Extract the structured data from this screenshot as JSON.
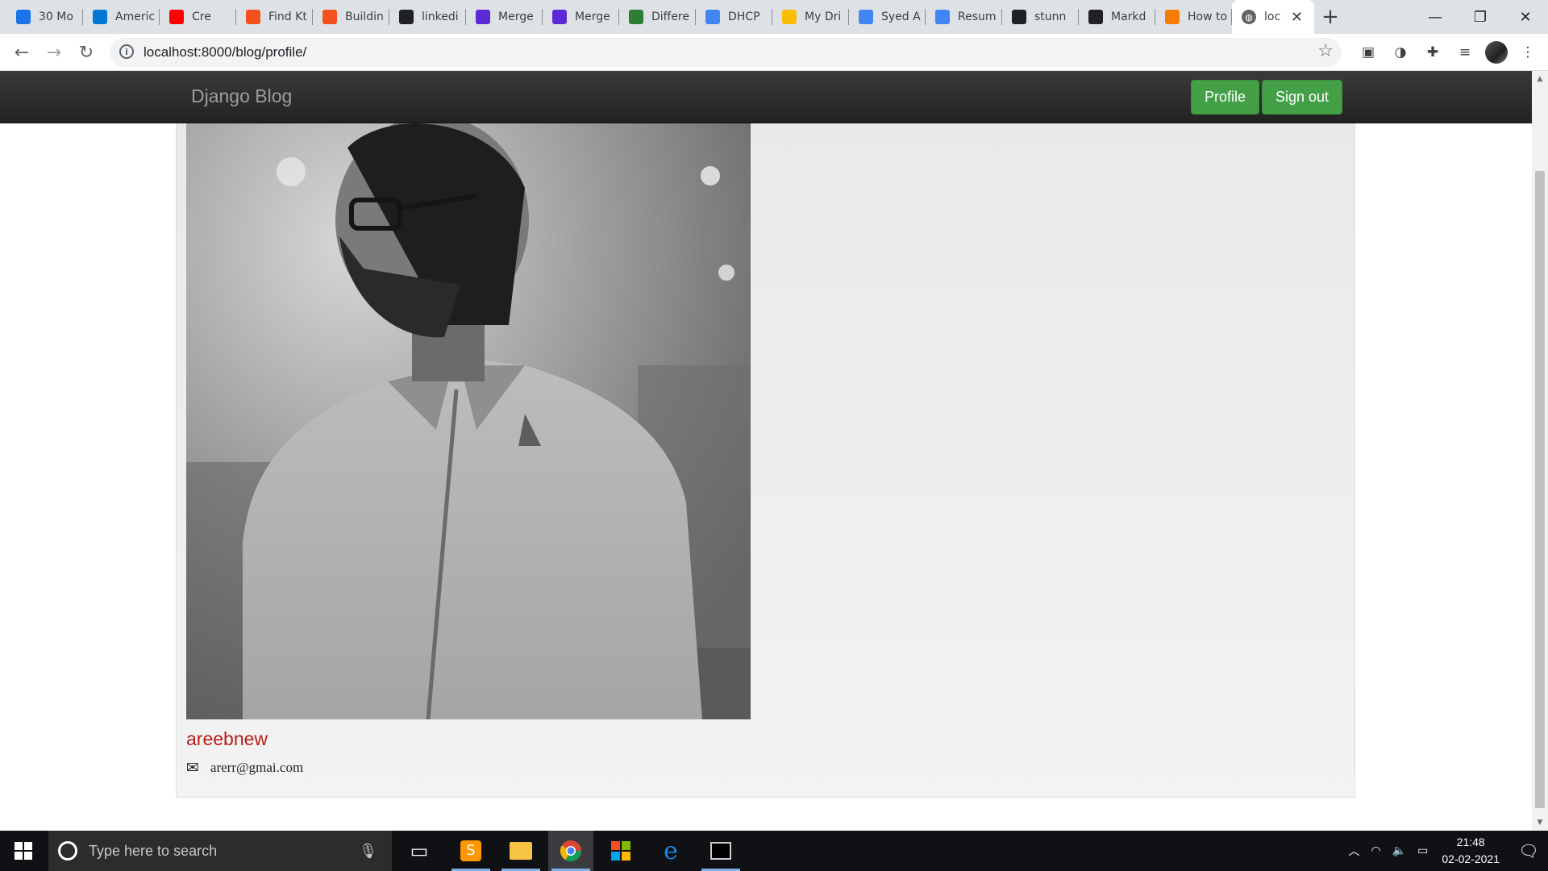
{
  "browser": {
    "tabs": [
      {
        "title": "30 Mo",
        "icon": "spiral-icon",
        "color": "#1a73e8"
      },
      {
        "title": "Americ",
        "icon": "azure-icon",
        "color": "#0078d4"
      },
      {
        "title": "Cre",
        "icon": "youtube-icon",
        "color": "#ff0000"
      },
      {
        "title": "Find Kt",
        "icon": "kotlin-icon",
        "color": "#f4511e"
      },
      {
        "title": "Buildin",
        "icon": "kotlin-icon",
        "color": "#f4511e"
      },
      {
        "title": "linkedi",
        "icon": "github-icon",
        "color": "#202124"
      },
      {
        "title": "Merge",
        "icon": "medium-icon",
        "color": "#5b2ad6"
      },
      {
        "title": "Merge",
        "icon": "medium-icon",
        "color": "#5b2ad6"
      },
      {
        "title": "Differe",
        "icon": "diff-icon",
        "color": "#2e7d32"
      },
      {
        "title": "DHCP",
        "icon": "google-icon",
        "color": "#4285f4"
      },
      {
        "title": "My Dri",
        "icon": "drive-icon",
        "color": "#fbbc04"
      },
      {
        "title": "Syed A",
        "icon": "docs-icon",
        "color": "#4285f4"
      },
      {
        "title": "Resum",
        "icon": "docs-icon",
        "color": "#4285f4"
      },
      {
        "title": "stunn",
        "icon": "github-icon",
        "color": "#202124"
      },
      {
        "title": "Markd",
        "icon": "github-icon",
        "color": "#202124"
      },
      {
        "title": "How to",
        "icon": "bird-icon",
        "color": "#f57c00"
      }
    ],
    "active_tab": {
      "title": "loc",
      "icon": "globe-icon"
    },
    "url": "localhost:8000/blog/profile/"
  },
  "site": {
    "brand": "Django Blog",
    "nav": {
      "profile_label": "Profile",
      "signout_label": "Sign out"
    },
    "accent_green": "#43a047"
  },
  "profile": {
    "username": "areebnew",
    "email": "arerr@gmai.com",
    "username_color": "#b71c1c"
  },
  "taskbar": {
    "search_placeholder": "Type here to search",
    "time": "21:48",
    "date": "02-02-2021"
  }
}
